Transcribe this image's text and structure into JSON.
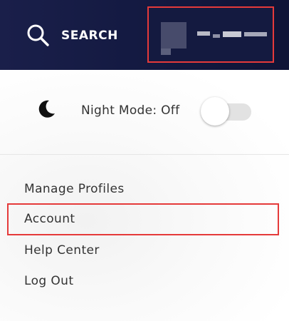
{
  "header": {
    "search_label": "SEARCH",
    "search_icon": "search-icon",
    "background_color": "#141a42"
  },
  "profile": {
    "highlight_color": "#e53a3a"
  },
  "menu": {
    "night_mode_label": "Night Mode: Off",
    "night_mode_on": false,
    "moon_icon": "moon-icon",
    "items": [
      {
        "label": "Manage Profiles"
      },
      {
        "label": "Account",
        "highlighted": true
      },
      {
        "label": "Help Center"
      },
      {
        "label": "Log Out"
      }
    ]
  }
}
